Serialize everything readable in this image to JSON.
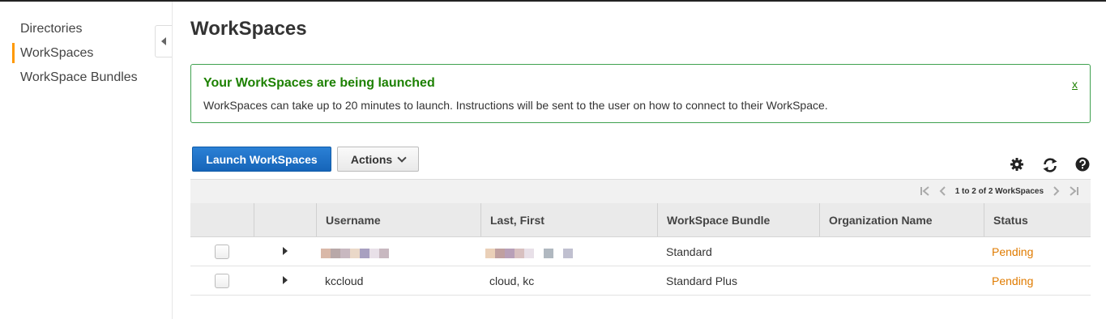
{
  "sidebar": {
    "items": [
      {
        "label": "Directories",
        "active": false
      },
      {
        "label": "WorkSpaces",
        "active": true
      },
      {
        "label": "WorkSpace Bundles",
        "active": false
      }
    ],
    "accent_color": "#ff9900"
  },
  "page": {
    "title": "WorkSpaces"
  },
  "alert": {
    "title": "Your WorkSpaces are being launched",
    "body": "WorkSpaces can take up to 20 minutes to launch. Instructions will be sent to the user on how to connect to their WorkSpace.",
    "close_label": "x",
    "color": "#1d8102"
  },
  "toolbar": {
    "launch_label": "Launch WorkSpaces",
    "actions_label": "Actions",
    "icons": [
      "gear-icon",
      "refresh-icon",
      "help-icon"
    ]
  },
  "pagination": {
    "text": "1 to 2 of 2 WorkSpaces"
  },
  "table": {
    "columns": [
      "",
      "",
      "Username",
      "Last, First",
      "WorkSpace Bundle",
      "Organization Name",
      "Status"
    ],
    "rows": [
      {
        "username": "",
        "last_first": "",
        "bundle": "Standard",
        "organization": "",
        "status": "Pending",
        "redacted": true
      },
      {
        "username": "kccloud",
        "last_first": "cloud, kc",
        "bundle": "Standard Plus",
        "organization": "",
        "status": "Pending",
        "redacted": false
      }
    ],
    "status_color": "#e07b00"
  }
}
